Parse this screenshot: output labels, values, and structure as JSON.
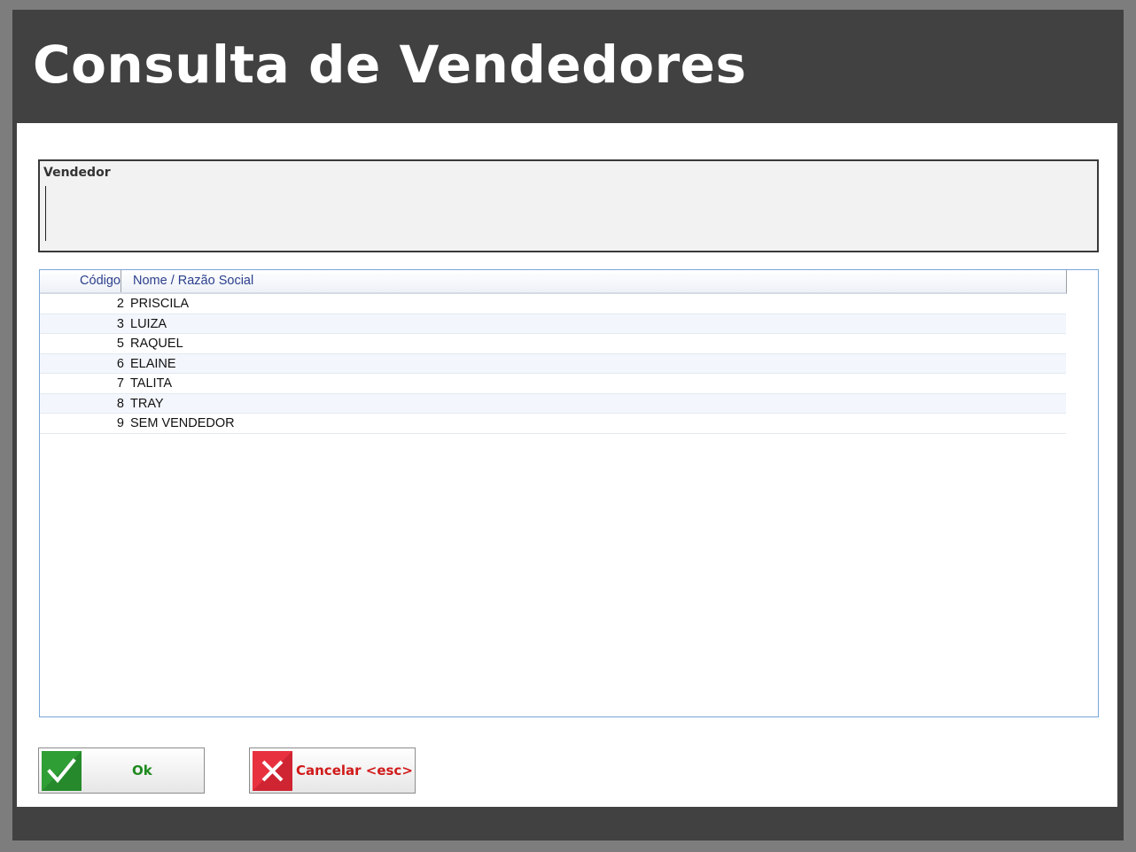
{
  "window": {
    "title": "Consulta de Vendedores"
  },
  "search": {
    "label": "Vendedor",
    "value": ""
  },
  "grid": {
    "columns": [
      "Código",
      "Nome / Razão Social"
    ],
    "rows": [
      {
        "codigo": "2",
        "nome": "PRISCILA"
      },
      {
        "codigo": "3",
        "nome": "LUIZA"
      },
      {
        "codigo": "5",
        "nome": "RAQUEL"
      },
      {
        "codigo": "6",
        "nome": "ELAINE"
      },
      {
        "codigo": "7",
        "nome": "TALITA"
      },
      {
        "codigo": "8",
        "nome": "TRAY"
      },
      {
        "codigo": "9",
        "nome": "SEM VENDEDOR"
      }
    ]
  },
  "buttons": {
    "ok_label": "Ok",
    "ok_icon": "check-icon",
    "cancel_label": "Cancelar <esc>",
    "cancel_icon": "close-icon"
  },
  "colors": {
    "title_bar": "#414141",
    "ok_green": "#1f8a1f",
    "cancel_red": "#d11a1a",
    "grid_border": "#7aa6d9",
    "header_text": "#2c3f8c"
  }
}
